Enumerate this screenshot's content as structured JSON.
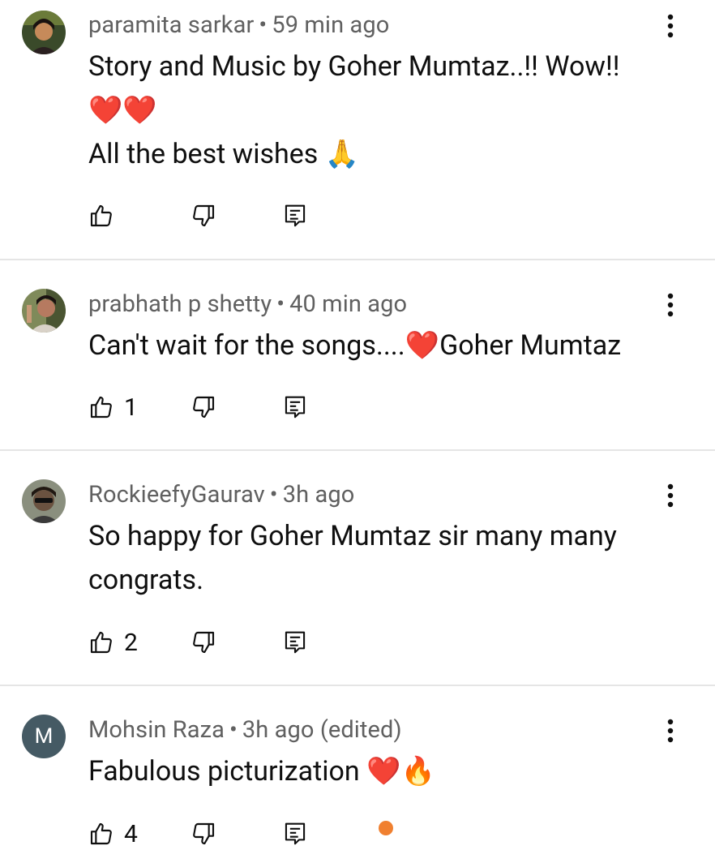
{
  "comments": [
    {
      "author": "paramita sarkar",
      "time": "59 min ago",
      "lines": [
        "Story and Music by Goher Mumtaz..!! Wow!!",
        "❤️❤️",
        "All the best wishes 🙏"
      ],
      "likes": ""
    },
    {
      "author": "prabhath p shetty",
      "time": "40 min ago",
      "lines": [
        "Can't wait for the songs....❤️Goher Mumtaz"
      ],
      "likes": "1"
    },
    {
      "author": "RockieefyGaurav",
      "time": "3h ago",
      "lines": [
        "So happy for Goher Mumtaz sir many many",
        "congrats."
      ],
      "likes": "2"
    },
    {
      "author": "Mohsin Raza",
      "time": "3h ago (edited)",
      "avatar_letter": "M",
      "lines": [
        "Fabulous picturization ❤️🔥"
      ],
      "likes": "4"
    }
  ],
  "separator": "•",
  "icons": {
    "like": "thumbs-up-icon",
    "dislike": "thumbs-down-icon",
    "reply": "reply-comment-icon",
    "menu": "more-vertical-icon"
  },
  "colors": {
    "text": "#0f0f0f",
    "meta": "#606060",
    "divider": "#e5e5e5",
    "avatar_letter_bg": "#455a64"
  }
}
